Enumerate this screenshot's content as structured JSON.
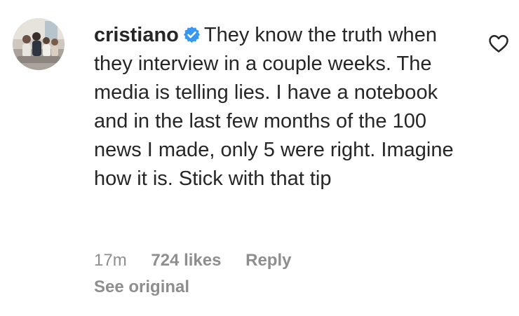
{
  "comment": {
    "username": "cristiano",
    "verified": true,
    "text": "They know the truth when they interview in a couple weeks. The media is telling lies. I have a notebook and in the last few months of the 100 news I made, only 5 were right. Imagine how it is. Stick with that tip",
    "time": "17m",
    "likes": "724 likes",
    "reply_label": "Reply",
    "see_original_label": "See original"
  },
  "icons": {
    "avatar": "profile-photo",
    "verified": "verified-badge-icon",
    "like": "heart-outline-icon"
  },
  "colors": {
    "text": "#262626",
    "secondary": "#8e8e8e",
    "verified_blue": "#3897f0"
  }
}
